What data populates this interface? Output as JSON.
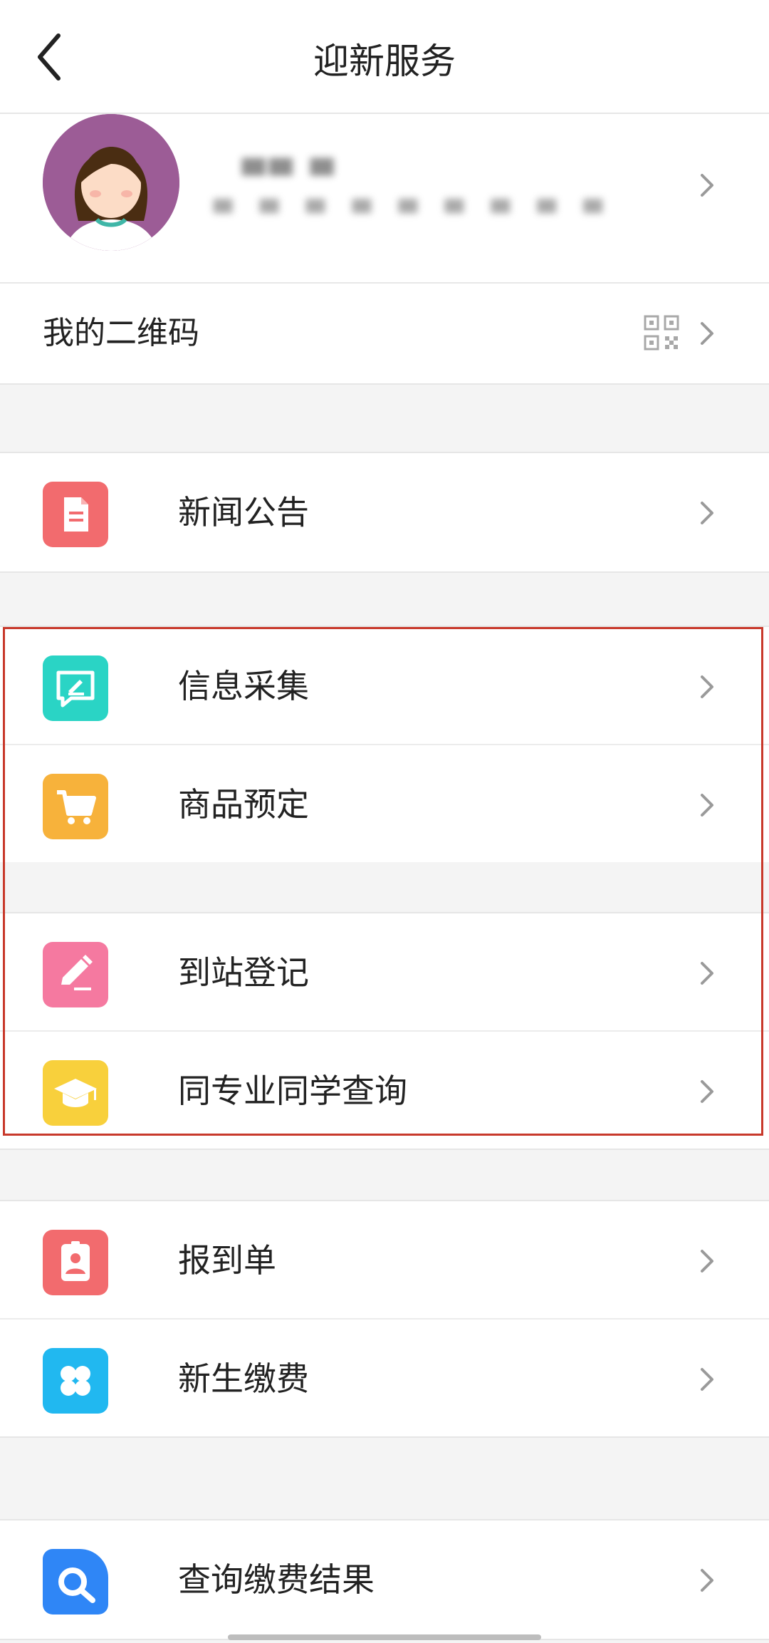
{
  "header": {
    "title": "迎新服务"
  },
  "profile": {
    "name": "▀▀ ▀",
    "subtitle": "▀ ▀ ▀ ▀ ▀ ▀ ▀ ▀ ▀"
  },
  "qr_row": {
    "label": "我的二维码"
  },
  "menu": {
    "news": "新闻公告",
    "info_collect": "信息采集",
    "goods_reserve": "商品预定",
    "arrival_register": "到站登记",
    "classmates_query": "同专业同学查询",
    "report_form": "报到单",
    "freshman_payment": "新生缴费",
    "payment_result": "查询缴费结果"
  },
  "colors": {
    "news_icon": "#f26b6e",
    "info_icon": "#2ad4c5",
    "goods_icon": "#f7b23b",
    "arrival_icon": "#f579a0",
    "classmates_icon": "#f8d03c",
    "report_icon": "#f26b6e",
    "payment_icon": "#21b8f0",
    "result_icon": "#2f86f6",
    "highlight_border": "#c8392b"
  }
}
